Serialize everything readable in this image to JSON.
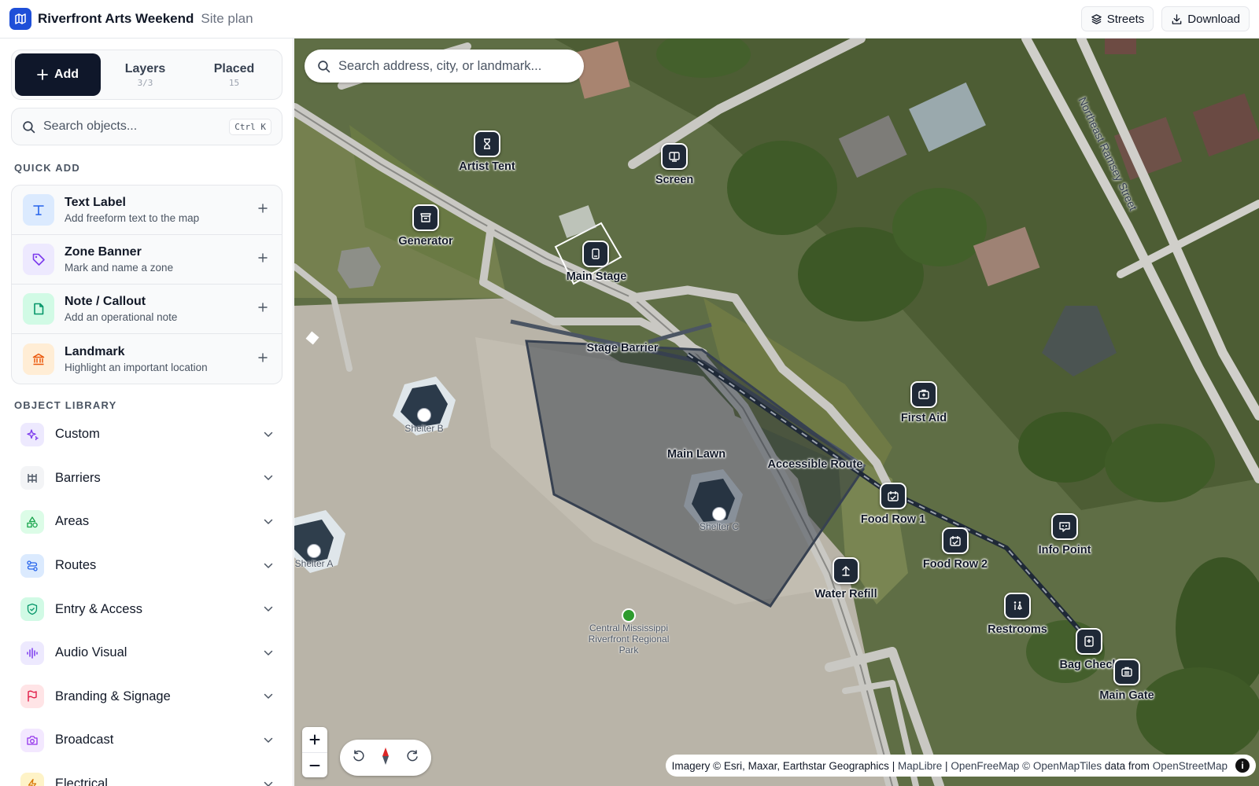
{
  "header": {
    "title": "Riverfront Arts Weekend",
    "subtitle": "Site plan",
    "streets_label": "Streets",
    "download_label": "Download"
  },
  "sidebar": {
    "add_label": "Add",
    "tabs": [
      {
        "label": "Layers",
        "count": "3/3"
      },
      {
        "label": "Placed",
        "count": "15"
      }
    ],
    "search_placeholder": "Search objects...",
    "search_shortcut": "Ctrl K",
    "quick_add_title": "QUICK ADD",
    "quick_add": [
      {
        "title": "Text Label",
        "desc": "Add freeform text to the map",
        "icon": "text-icon",
        "color": "#2563eb",
        "bg": "#dbeafe"
      },
      {
        "title": "Zone Banner",
        "desc": "Mark and name a zone",
        "icon": "tag-icon",
        "color": "#7c3aed",
        "bg": "#ede9fe"
      },
      {
        "title": "Note / Callout",
        "desc": "Add an operational note",
        "icon": "note-icon",
        "color": "#059669",
        "bg": "#d1fae5"
      },
      {
        "title": "Landmark",
        "desc": "Highlight an important location",
        "icon": "landmark-icon",
        "color": "#ea580c",
        "bg": "#ffedd5"
      }
    ],
    "library_title": "OBJECT LIBRARY",
    "library": [
      {
        "label": "Custom",
        "icon": "sparkles-icon",
        "color": "#7c3aed",
        "bg": "#ede9fe"
      },
      {
        "label": "Barriers",
        "icon": "fence-icon",
        "color": "#4b5563",
        "bg": "#f3f4f6"
      },
      {
        "label": "Areas",
        "icon": "shapes-icon",
        "color": "#16a34a",
        "bg": "#dcfce7"
      },
      {
        "label": "Routes",
        "icon": "route-icon",
        "color": "#2563eb",
        "bg": "#dbeafe"
      },
      {
        "label": "Entry & Access",
        "icon": "shield-icon",
        "color": "#059669",
        "bg": "#d1fae5"
      },
      {
        "label": "Audio Visual",
        "icon": "audio-icon",
        "color": "#7c3aed",
        "bg": "#ede9fe"
      },
      {
        "label": "Branding & Signage",
        "icon": "flag-icon",
        "color": "#e11d48",
        "bg": "#ffe4e6"
      },
      {
        "label": "Broadcast",
        "icon": "camera-icon",
        "color": "#9333ea",
        "bg": "#f3e8ff"
      },
      {
        "label": "Electrical",
        "icon": "bolt-icon",
        "color": "#d97706",
        "bg": "#fef3c7"
      }
    ]
  },
  "map": {
    "search_placeholder": "Search address, city, or landmark...",
    "markers": [
      {
        "label": "Artist Tent",
        "icon": "artist-tent-icon"
      },
      {
        "label": "Screen",
        "icon": "screen-icon"
      },
      {
        "label": "Generator",
        "icon": "generator-icon"
      },
      {
        "label": "Main Stage",
        "icon": "stage-icon"
      },
      {
        "label": "First Aid",
        "icon": "first-aid-icon"
      },
      {
        "label": "Food Row 1",
        "icon": "food-icon"
      },
      {
        "label": "Food Row 2",
        "icon": "food-icon"
      },
      {
        "label": "Info Point",
        "icon": "info-icon"
      },
      {
        "label": "Water Refill",
        "icon": "water-icon"
      },
      {
        "label": "Restrooms",
        "icon": "restroom-icon"
      },
      {
        "label": "Bag Check",
        "icon": "bag-icon"
      },
      {
        "label": "Main Gate",
        "icon": "gate-icon"
      }
    ],
    "zone_labels": {
      "stage_barrier": "Stage Barrier",
      "main_lawn": "Main Lawn",
      "accessible_route": "Accessible Route"
    },
    "shelters": [
      "Shelter B",
      "Shelter C",
      "Shelter A"
    ],
    "park_name": "Central Mississippi Riverfront Regional Park",
    "street_name": "Northeast Ramsey Street",
    "attribution": {
      "imagery": "Imagery © Esri, Maxar, Earthstar Geographics",
      "sep": "|",
      "maplibre": "MapLibre",
      "openfreemap": "OpenFreeMap",
      "openmaptiles": "© OpenMapTiles",
      "data_from": "data from",
      "osm": "OpenStreetMap"
    }
  }
}
